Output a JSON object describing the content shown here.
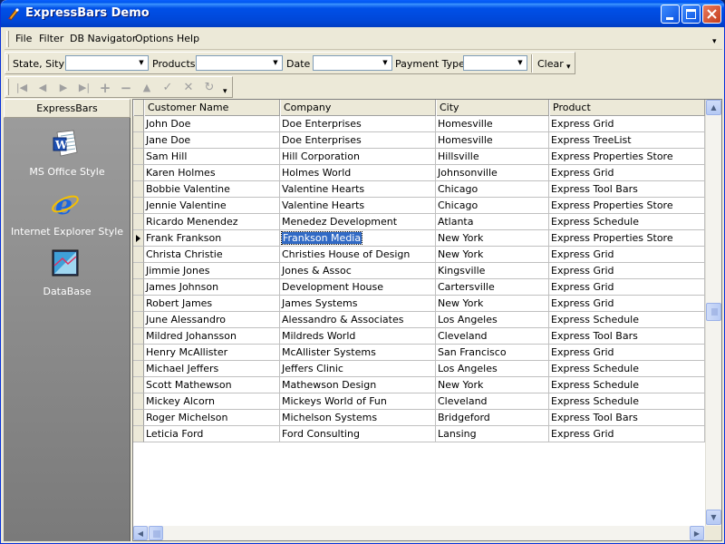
{
  "window": {
    "title": "ExpressBars Demo"
  },
  "menubar": {
    "items": [
      "File",
      "Filter",
      "DB Navigator",
      "Options",
      "Help"
    ]
  },
  "filterbar": {
    "state_label": "State, Sity",
    "state_value": "",
    "products_label": "Products",
    "products_value": "",
    "date_label": "Date",
    "date_value": "",
    "payment_label": "Payment Type",
    "payment_value": "",
    "clear_label": "Clear"
  },
  "navbar": {
    "buttons": [
      "first",
      "prior",
      "next",
      "last",
      "insert",
      "delete",
      "edit",
      "post",
      "cancel",
      "refresh"
    ]
  },
  "sidebar": {
    "header": "ExpressBars",
    "items": [
      {
        "label": "MS Office Style",
        "icon": "word-document-icon"
      },
      {
        "label": "Internet Explorer Style",
        "icon": "internet-explorer-icon"
      },
      {
        "label": "DataBase",
        "icon": "database-icon"
      }
    ]
  },
  "grid": {
    "columns": [
      "Customer Name",
      "Company",
      "City",
      "Product"
    ],
    "current_row": 7,
    "selected_cell": "Frankson Media",
    "rows": [
      [
        "John Doe",
        "Doe Enterprises",
        "Homesville",
        "Express Grid"
      ],
      [
        "Jane Doe",
        "Doe Enterprises",
        "Homesville",
        "Express TreeList"
      ],
      [
        "Sam Hill",
        "Hill Corporation",
        "Hillsville",
        "Express Properties Store"
      ],
      [
        "Karen Holmes",
        "Holmes World",
        "Johnsonville",
        "Express Grid"
      ],
      [
        "Bobbie Valentine",
        "Valentine Hearts",
        "Chicago",
        "Express Tool Bars"
      ],
      [
        "Jennie Valentine",
        "Valentine Hearts",
        "Chicago",
        "Express Properties Store"
      ],
      [
        "Ricardo Menendez",
        "Menedez Development",
        "Atlanta",
        "Express Schedule"
      ],
      [
        "Frank Frankson",
        "Frankson Media",
        "New York",
        "Express Properties Store"
      ],
      [
        "Christa Christie",
        "Christies House of Design",
        "New York",
        "Express Grid"
      ],
      [
        "Jimmie Jones",
        "Jones & Assoc",
        "Kingsville",
        "Express Grid"
      ],
      [
        "James Johnson",
        "Development House",
        "Cartersville",
        "Express Grid"
      ],
      [
        "Robert James",
        "James Systems",
        "New York",
        "Express Grid"
      ],
      [
        "June Alessandro",
        "Alessandro & Associates",
        "Los Angeles",
        "Express Schedule"
      ],
      [
        "Mildred Johansson",
        "Mildreds World",
        "Cleveland",
        "Express Tool Bars"
      ],
      [
        "Henry McAllister",
        "McAllister Systems",
        "San Francisco",
        "Express Grid"
      ],
      [
        "Michael Jeffers",
        "Jeffers Clinic",
        "Los Angeles",
        "Express Schedule"
      ],
      [
        "Scott Mathewson",
        "Mathewson Design",
        "New York",
        "Express Schedule"
      ],
      [
        "Mickey Alcorn",
        "Mickeys World of Fun",
        "Cleveland",
        "Express Schedule"
      ],
      [
        "Roger Michelson",
        "Michelson Systems",
        "Bridgeford",
        "Express Tool Bars"
      ],
      [
        "Leticia Ford",
        "Ford Consulting",
        "Lansing",
        "Express Grid"
      ]
    ]
  }
}
